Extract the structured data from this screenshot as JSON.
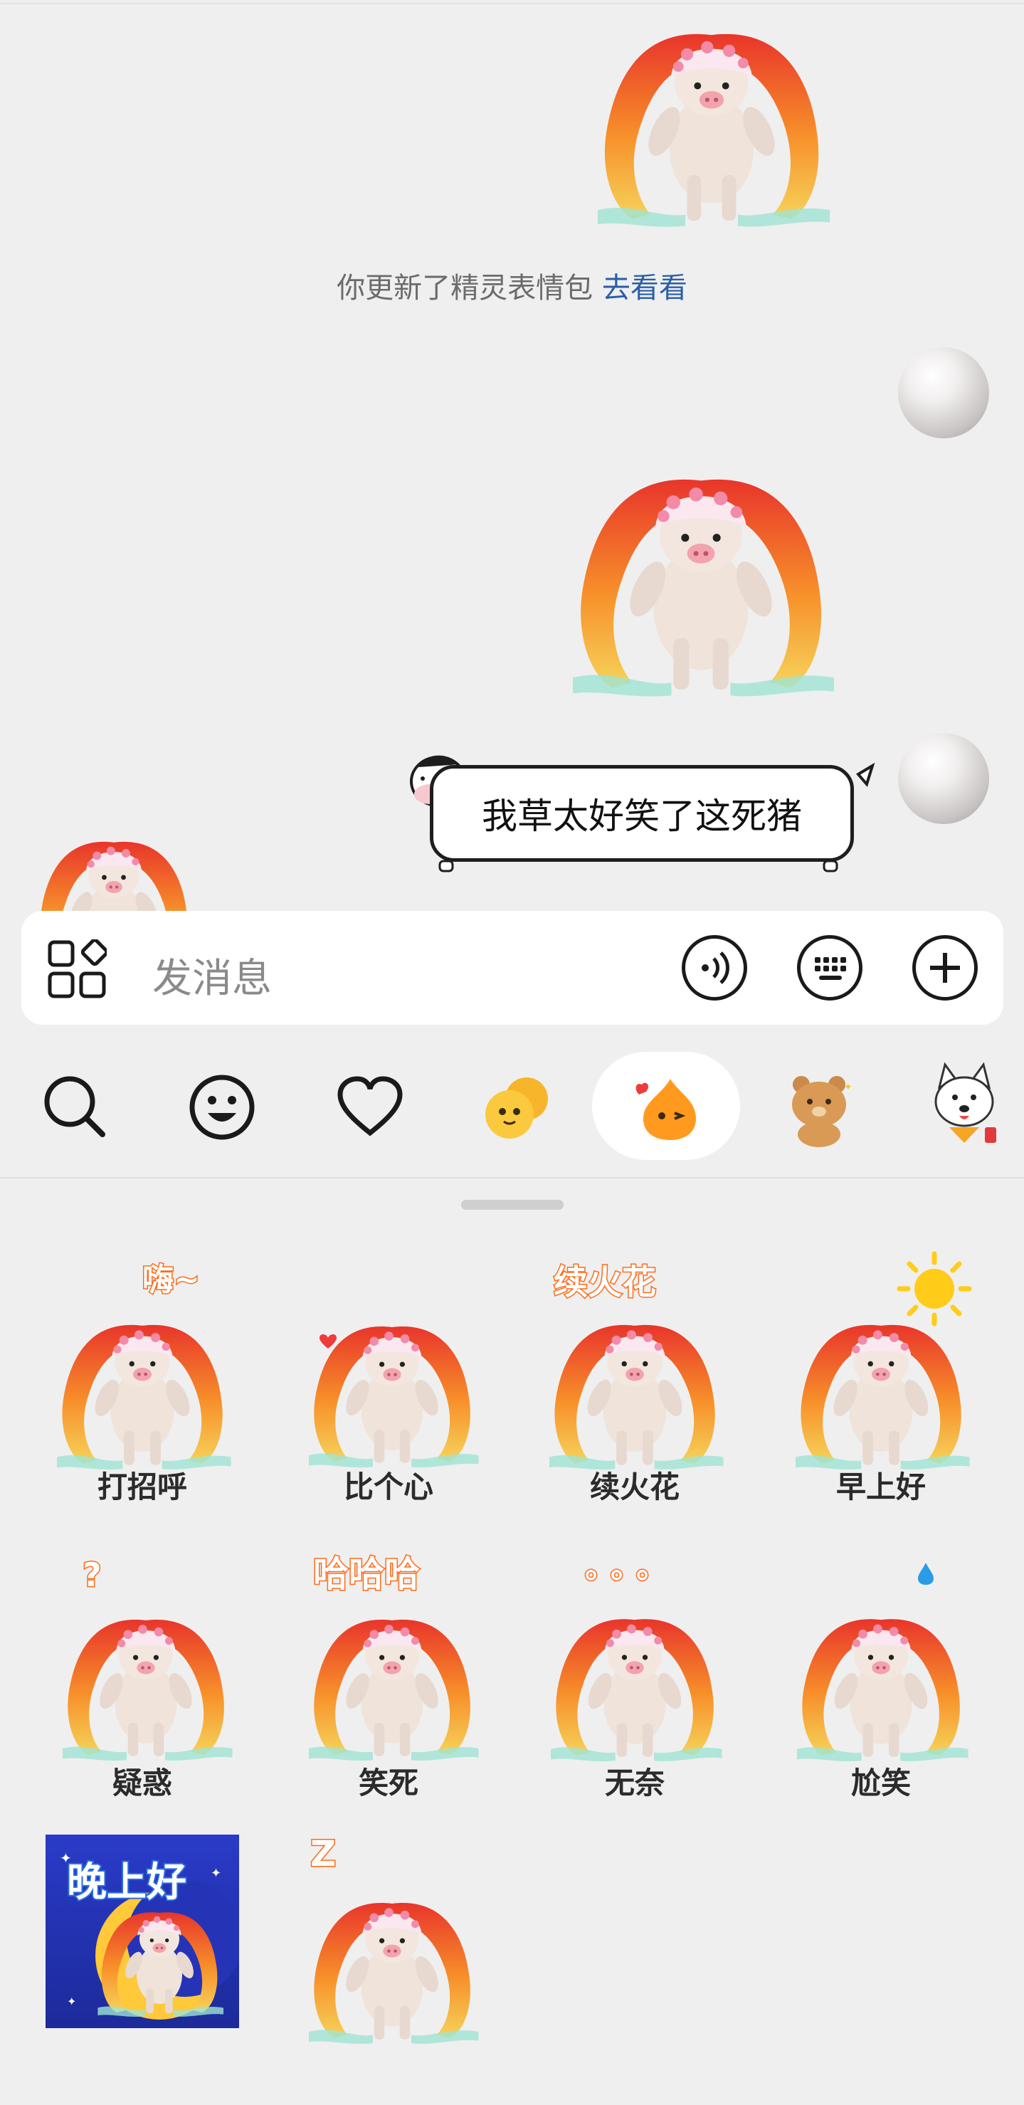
{
  "notice": {
    "text": "你更新了精灵表情包",
    "link": "去看看"
  },
  "bubble": {
    "text": "我草太好笑了这死猪"
  },
  "input": {
    "placeholder": "发消息"
  },
  "tabs": [
    {
      "icon": "search-icon"
    },
    {
      "icon": "smiley-icon"
    },
    {
      "icon": "heart-icon"
    },
    {
      "icon": "yellow-sprite-icon"
    },
    {
      "icon": "orange-sprite-icon",
      "active": true
    },
    {
      "icon": "bear-icon"
    },
    {
      "icon": "dog-icon"
    }
  ],
  "stickers": [
    {
      "label": "打招呼",
      "caption": "嗨~"
    },
    {
      "label": "比个心",
      "caption": ""
    },
    {
      "label": "续火花",
      "caption": "续火花"
    },
    {
      "label": "早上好",
      "caption": ""
    },
    {
      "label": "疑惑",
      "caption": "?"
    },
    {
      "label": "笑死",
      "caption": "哈哈哈"
    },
    {
      "label": "无奈",
      "caption": "。。。"
    },
    {
      "label": "尬笑",
      "caption": ""
    },
    {
      "label": "",
      "caption": "晚上好"
    },
    {
      "label": "",
      "caption": "Z"
    }
  ],
  "colors": {
    "link": "#2a5ea8",
    "ribbon_red": "#e8352b",
    "ribbon_orange": "#f7902a",
    "pig": "#efe3da",
    "panel_bg": "#efefef"
  }
}
